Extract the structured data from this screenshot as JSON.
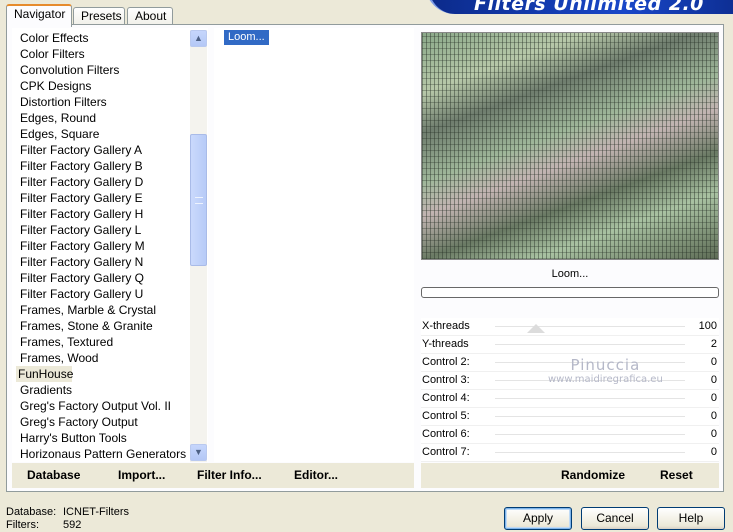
{
  "tabs": [
    "Navigator",
    "Presets",
    "About"
  ],
  "banner": {
    "title": "Filters Unlimited 2.0"
  },
  "categories": [
    "Color Effects",
    "Color Filters",
    "Convolution Filters",
    "CPK Designs",
    "Distortion Filters",
    "Edges, Round",
    "Edges, Square",
    "Filter Factory Gallery A",
    "Filter Factory Gallery B",
    "Filter Factory Gallery D",
    "Filter Factory Gallery E",
    "Filter Factory Gallery H",
    "Filter Factory Gallery L",
    "Filter Factory Gallery M",
    "Filter Factory Gallery N",
    "Filter Factory Gallery Q",
    "Filter Factory Gallery U",
    "Frames, Marble & Crystal",
    "Frames, Stone & Granite",
    "Frames, Textured",
    "Frames, Wood",
    "FunHouse",
    "Gradients",
    "Greg's Factory Output Vol. II",
    "Greg's Factory Output",
    "Harry's Button Tools",
    "Horizonaus Pattern Generators"
  ],
  "selected_category": "FunHouse",
  "filters": [
    "Loom..."
  ],
  "preview": {
    "filter_name": "Loom..."
  },
  "controls": [
    {
      "label": "X-threads",
      "value": "100"
    },
    {
      "label": "Y-threads",
      "value": "2"
    },
    {
      "label": "Control 2:",
      "value": "0"
    },
    {
      "label": "Control 3:",
      "value": "0"
    },
    {
      "label": "Control 4:",
      "value": "0"
    },
    {
      "label": "Control 5:",
      "value": "0"
    },
    {
      "label": "Control 6:",
      "value": "0"
    },
    {
      "label": "Control 7:",
      "value": "0"
    }
  ],
  "watermark": {
    "line1": "Pinuccia",
    "line2": "www.maidiregrafica.eu"
  },
  "toolbar": {
    "database": "Database",
    "import": "Import...",
    "filter_info": "Filter Info...",
    "editor": "Editor...",
    "randomize": "Randomize",
    "reset": "Reset"
  },
  "footer": {
    "database_label": "Database:",
    "database_value": "ICNET-Filters",
    "filters_label": "Filters:",
    "filters_value": "592"
  },
  "buttons": {
    "apply": "Apply",
    "cancel": "Cancel",
    "help": "Help"
  }
}
